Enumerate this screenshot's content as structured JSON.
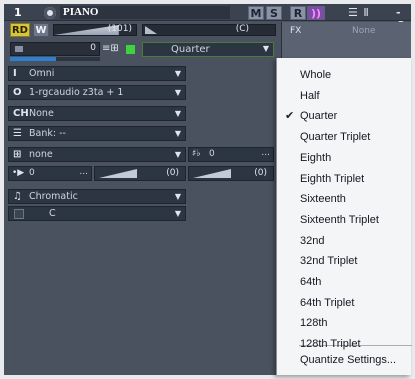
{
  "header": {
    "track_number": "1",
    "track_name": "PIANO",
    "mute_label": "M",
    "solo_label": "S",
    "record_label": "R",
    "monitor_label": "))",
    "icons_label": "☰ Ⅱ",
    "ellipsis": "- C"
  },
  "strip": {
    "rd_label": "RD",
    "w_label": "W",
    "volume_value": "(101)",
    "volume_level": 0.79,
    "pan_value": "(C)",
    "meter_value": "0",
    "grid_icon": "≡⊞",
    "quantize_value": "Quarter"
  },
  "fx": {
    "label": "FX",
    "value": "None"
  },
  "inspector": {
    "input": {
      "icon": "I",
      "label": "Omni"
    },
    "output": {
      "icon": "O",
      "label": "1-rgcaudio z3ta + 1"
    },
    "channel": {
      "icon": "CH",
      "label": "None"
    },
    "bank": {
      "icon": "☰",
      "label": "Bank: --"
    },
    "patch": {
      "icon": "⊞",
      "label": "none"
    },
    "key": {
      "icon": "♯♭",
      "label": "0",
      "dots": "..."
    },
    "transpose": {
      "icon": "•▶",
      "label": "0",
      "dots": "..."
    },
    "velocity_value": "(0)",
    "time_value": "(0)",
    "scale": {
      "icon": "♫",
      "label": "Chromatic"
    },
    "root": {
      "label": "C"
    }
  },
  "menu": {
    "items": [
      {
        "label": "Whole",
        "checked": false
      },
      {
        "label": "Half",
        "checked": false
      },
      {
        "label": "Quarter",
        "checked": true
      },
      {
        "label": "Quarter Triplet",
        "checked": false
      },
      {
        "label": "Eighth",
        "checked": false
      },
      {
        "label": "Eighth Triplet",
        "checked": false
      },
      {
        "label": "Sixteenth",
        "checked": false
      },
      {
        "label": "Sixteenth Triplet",
        "checked": false
      },
      {
        "label": "32nd",
        "checked": false
      },
      {
        "label": "32nd Triplet",
        "checked": false
      },
      {
        "label": "64th",
        "checked": false
      },
      {
        "label": "64th Triplet",
        "checked": false
      },
      {
        "label": "128th",
        "checked": false
      },
      {
        "label": "128th Triplet",
        "checked": false
      }
    ],
    "settings_label": "Quantize Settings...",
    "check_glyph": "✔"
  },
  "colors": {
    "rd_button": "#d8c43a",
    "monitor_button": "#7d4ca8",
    "meter_blue": "#2d7fd0",
    "green_indicator": "#3ed33e"
  }
}
